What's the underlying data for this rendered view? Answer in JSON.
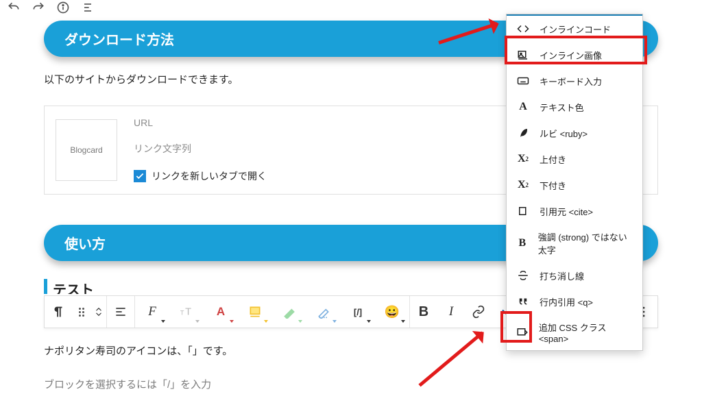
{
  "headings": {
    "download": "ダウンロード方法",
    "usage": "使い方"
  },
  "body": {
    "download_desc": "以下のサイトからダウンロードできます。",
    "napolitan": "ナポリタン寿司のアイコンは、「」です。",
    "select_hint": "ブロックを選択するには「/」を入力",
    "test": "テスト"
  },
  "blogcard": {
    "thumb": "Blogcard",
    "url_label": "URL",
    "linktext_label": "リンク文字列",
    "newtab_label": "リンクを新しいタブで開く"
  },
  "toolbar": {
    "bold": "B",
    "italic": "I",
    "bracket": "[/]",
    "serif_f": "F",
    "red_a": "A",
    "font_t": "T"
  },
  "dropdown": {
    "items": [
      {
        "label": "インラインコード",
        "icon": "code-icon"
      },
      {
        "label": "インライン画像",
        "icon": "image-icon"
      },
      {
        "label": "キーボード入力",
        "icon": "keyboard-icon"
      },
      {
        "label": "テキスト色",
        "icon": "text-a-icon"
      },
      {
        "label": "ルビ <ruby>",
        "icon": "feather-icon"
      },
      {
        "label": "上付き",
        "icon": "superscript-icon"
      },
      {
        "label": "下付き",
        "icon": "subscript-icon"
      },
      {
        "label": "引用元 <cite>",
        "icon": "cite-icon"
      },
      {
        "label": "強調 (strong) ではない太字",
        "icon": "bold-icon"
      },
      {
        "label": "打ち消し線",
        "icon": "strikethrough-icon"
      },
      {
        "label": "行内引用 <q>",
        "icon": "quote-icon"
      },
      {
        "label": "追加 CSS クラス <span>",
        "icon": "css-span-icon"
      }
    ]
  }
}
